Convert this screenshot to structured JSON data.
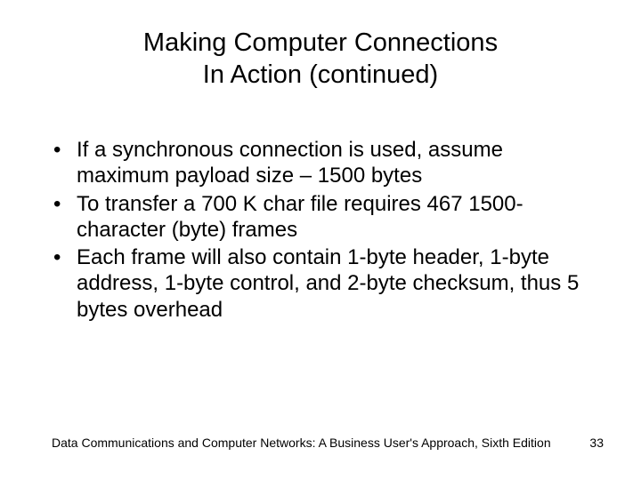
{
  "title_line1": "Making Computer Connections",
  "title_line2": "In Action (continued)",
  "bullets": [
    "If a synchronous connection is used, assume maximum payload size – 1500 bytes",
    "To transfer a 700 K char file requires 467 1500-character (byte) frames",
    "Each frame will also contain 1-byte header, 1-byte address, 1-byte control, and 2-byte checksum, thus 5 bytes overhead"
  ],
  "footer_text": "Data Communications and Computer Networks: A Business User's Approach, Sixth Edition",
  "page_number": "33"
}
